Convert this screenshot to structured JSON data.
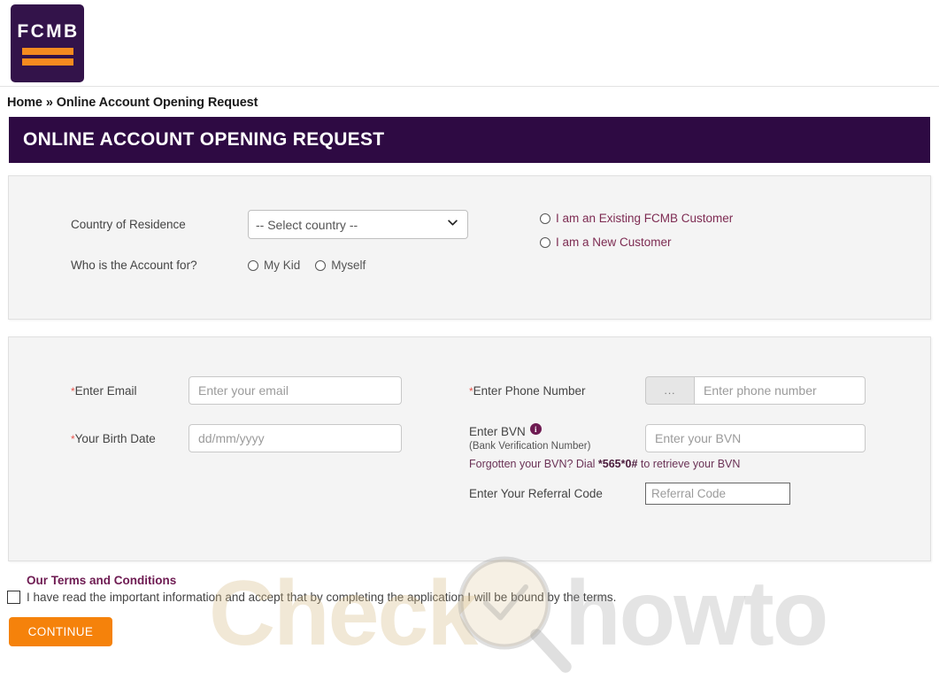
{
  "brand": {
    "logo_text": "FCMB",
    "purple": "#2e0a43",
    "orange": "#f5820b",
    "accent_maroon": "#6e1b52"
  },
  "breadcrumb": {
    "text": "Home » Online Account Opening Request"
  },
  "banner": {
    "title": "ONLINE ACCOUNT OPENING REQUEST"
  },
  "panel_one": {
    "country_label": "Country of Residence",
    "country_selected": "-- Select country --",
    "country_options": [
      "-- Select country --"
    ],
    "who_label": "Who is the Account for?",
    "who_options": [
      {
        "label": "My Kid",
        "selected": false
      },
      {
        "label": "Myself",
        "selected": false
      }
    ],
    "customer_options": [
      {
        "label": "I am an Existing FCMB Customer",
        "selected": false
      },
      {
        "label": "I am a New Customer",
        "selected": false
      }
    ]
  },
  "panel_two": {
    "email_label": "Enter Email",
    "email_required": "*",
    "email_value": "",
    "email_placeholder": "Enter your email",
    "birth_label": "Your Birth Date",
    "birth_required": "*",
    "birth_value": "",
    "birth_placeholder": "dd/mm/yyyy",
    "phone_label": "Enter Phone Number",
    "phone_required": "*",
    "phone_prefix": "...",
    "phone_value": "",
    "phone_placeholder": "Enter phone number",
    "bvn_label": "Enter BVN",
    "bvn_sub_label": "(Bank Verification Number)",
    "bvn_value": "",
    "bvn_placeholder": "Enter your BVN",
    "bvn_hint_before": "Forgotten your BVN? Dial ",
    "bvn_hint_code": "*565*0#",
    "bvn_hint_after": " to retrieve your BVN",
    "referral_label": "Enter Your Referral Code",
    "referral_value": "",
    "referral_placeholder": "Referral Code"
  },
  "terms": {
    "title": "Our Terms and Conditions",
    "text": "I have read the important information and accept that by completing the application I will be bound by the terms.",
    "checked": false
  },
  "actions": {
    "continue_label": "CONTINUE"
  },
  "watermark": {
    "text_one": "Check",
    "text_two": "howto"
  }
}
